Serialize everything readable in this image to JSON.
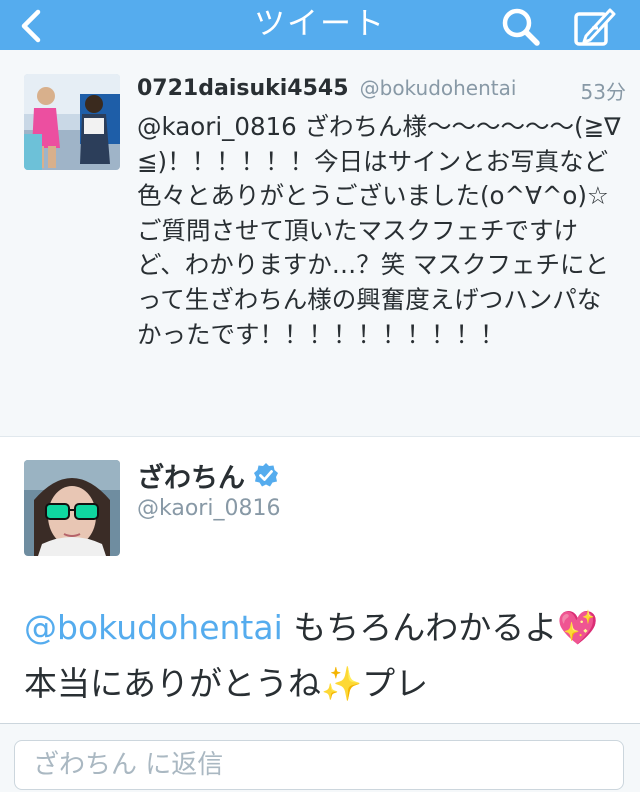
{
  "nav": {
    "title": "ツイート",
    "back_icon": "chevron-left-icon",
    "search_icon": "search-icon",
    "compose_icon": "compose-icon",
    "bar_color": "#55acee"
  },
  "original_tweet": {
    "display_name": "0721daisuki4545",
    "handle": "@bokudohentai",
    "time": "53分",
    "text": "@kaori_0816 ざわちん様〜〜〜〜〜〜(≧∇≦)！！！！！！今日はサインとお写真など色々とありがとうございました(o^∀^o)☆ご質問させて頂いたマスクフェチですけど、わかりますか…？笑 マスクフェチにとって生ざわちん様の興奮度えげつハンパなかったです！！！！！！！！！！"
  },
  "reply_tweet": {
    "display_name": "ざわちん",
    "verified_icon": "verified-badge-icon",
    "handle": "@kaori_0816",
    "mention": "@bokudohentai",
    "text_part1": " もちろんわかるよ",
    "emoji_heart": "💖",
    "text_part2": "本当にありがとうね",
    "emoji_sparkles": "✨",
    "text_part3": "プレ"
  },
  "reply_box": {
    "placeholder": "ざわちん に返信"
  },
  "colors": {
    "accent": "#55acee",
    "secondary_text": "#8899a6",
    "primary_text": "#292f33"
  }
}
